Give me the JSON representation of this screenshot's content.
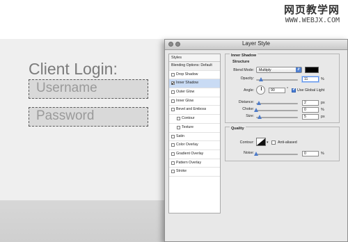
{
  "watermark": {
    "line1": "网页教学网",
    "line2": "WWW.WEBJX.COM"
  },
  "login": {
    "title": "Client Login:",
    "username_placeholder": "Username",
    "password_placeholder": "Password"
  },
  "dialog": {
    "title": "Layer Style",
    "styles_header": "Styles",
    "styles_list": [
      {
        "label": "Blending Options: Default",
        "type": "plain"
      },
      {
        "label": "Drop Shadow",
        "checked": false
      },
      {
        "label": "Inner Shadow",
        "checked": true,
        "selected": true
      },
      {
        "label": "Outer Glow",
        "checked": false
      },
      {
        "label": "Inner Glow",
        "checked": false
      },
      {
        "label": "Bevel and Emboss",
        "checked": false
      },
      {
        "label": "Contour",
        "checked": false,
        "indent": true
      },
      {
        "label": "Texture",
        "checked": false,
        "indent": true
      },
      {
        "label": "Satin",
        "checked": false
      },
      {
        "label": "Color Overlay",
        "checked": false
      },
      {
        "label": "Gradient Overlay",
        "checked": false
      },
      {
        "label": "Pattern Overlay",
        "checked": false
      },
      {
        "label": "Stroke",
        "checked": false
      }
    ],
    "inner_shadow": {
      "section_title": "Inner Shadow",
      "structure_title": "Structure",
      "blend_mode_label": "Blend Mode:",
      "blend_mode_value": "Multiply",
      "shadow_color": "#000000",
      "opacity_label": "Opacity:",
      "opacity_value": "11",
      "opacity_unit": "%",
      "angle_label": "Angle:",
      "angle_value": "90",
      "angle_unit": "°",
      "use_global_light_label": "Use Global Light",
      "use_global_light_checked": true,
      "distance_label": "Distance:",
      "distance_value": "2",
      "distance_unit": "px",
      "choke_label": "Choke:",
      "choke_value": "0",
      "choke_unit": "%",
      "size_label": "Size:",
      "size_value": "5",
      "size_unit": "px"
    },
    "quality": {
      "section_title": "Quality",
      "contour_label": "Contour:",
      "anti_aliased_label": "Anti-aliased",
      "anti_aliased_checked": false,
      "noise_label": "Noise:",
      "noise_value": "0",
      "noise_unit": "%"
    }
  }
}
